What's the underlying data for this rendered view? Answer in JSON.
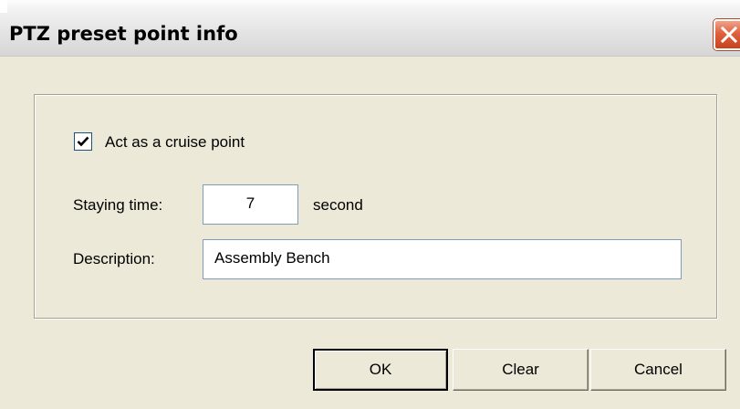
{
  "dialog": {
    "title": "PTZ preset point info",
    "close_icon": "close-icon",
    "cruise_checkbox": {
      "label": "Act as a cruise point",
      "checked": true
    },
    "staying_time": {
      "label": "Staying time:",
      "value": "7",
      "unit": "second"
    },
    "description": {
      "label": "Description:",
      "value": "Assembly Bench"
    },
    "buttons": {
      "ok": "OK",
      "clear": "Clear",
      "cancel": "Cancel"
    }
  },
  "colors": {
    "dialog_background": "#ECE9D8",
    "close_button": "#E0603D",
    "input_border": "#7F9DB9"
  }
}
